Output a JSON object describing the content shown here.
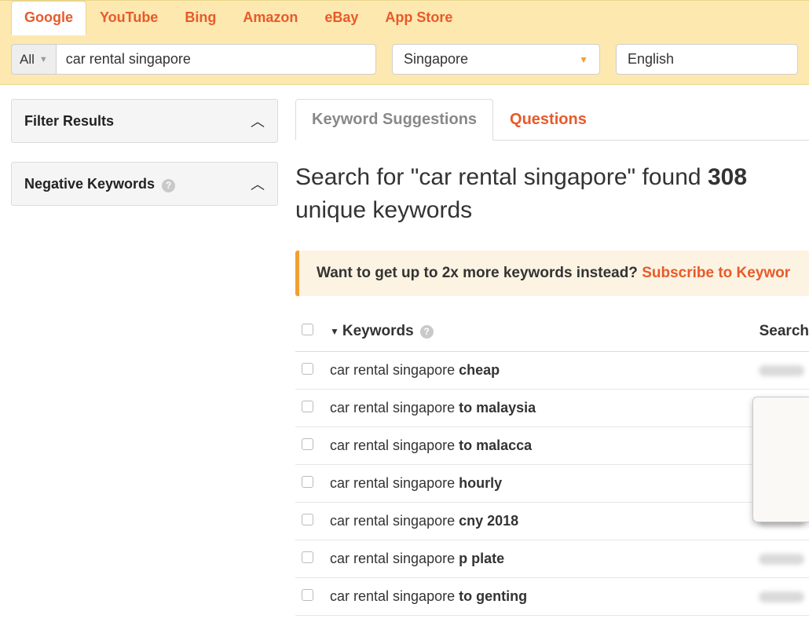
{
  "sourceTabs": [
    "Google",
    "YouTube",
    "Bing",
    "Amazon",
    "eBay",
    "App Store"
  ],
  "activeSourceTab": 0,
  "filterLabel": "All",
  "searchValue": "car rental singapore",
  "countryValue": "Singapore",
  "languageValue": "English",
  "sidebar": {
    "filterResults": "Filter Results",
    "negativeKeywords": "Negative Keywords"
  },
  "resultTabs": {
    "suggestions": "Keyword Suggestions",
    "questions": "Questions"
  },
  "headline": {
    "prefix": "Search for \"",
    "query": "car rental singapore",
    "mid": "\" found ",
    "count": "308",
    "suffix": " unique keywords"
  },
  "promo": {
    "text": "Want to get up to 2x more keywords instead? ",
    "link": "Subscribe to Keywor"
  },
  "columns": {
    "keywords": "Keywords",
    "searchVolume": "Search "
  },
  "rows": [
    {
      "base": "car rental singapore ",
      "bold": "cheap"
    },
    {
      "base": "car rental singapore ",
      "bold": "to malaysia"
    },
    {
      "base": "car rental singapore ",
      "bold": "to malacca"
    },
    {
      "base": "car rental singapore ",
      "bold": "hourly"
    },
    {
      "base": "car rental singapore ",
      "bold": "cny 2018"
    },
    {
      "base": "car rental singapore ",
      "bold": "p plate"
    },
    {
      "base": "car rental singapore ",
      "bold": "to genting"
    }
  ]
}
